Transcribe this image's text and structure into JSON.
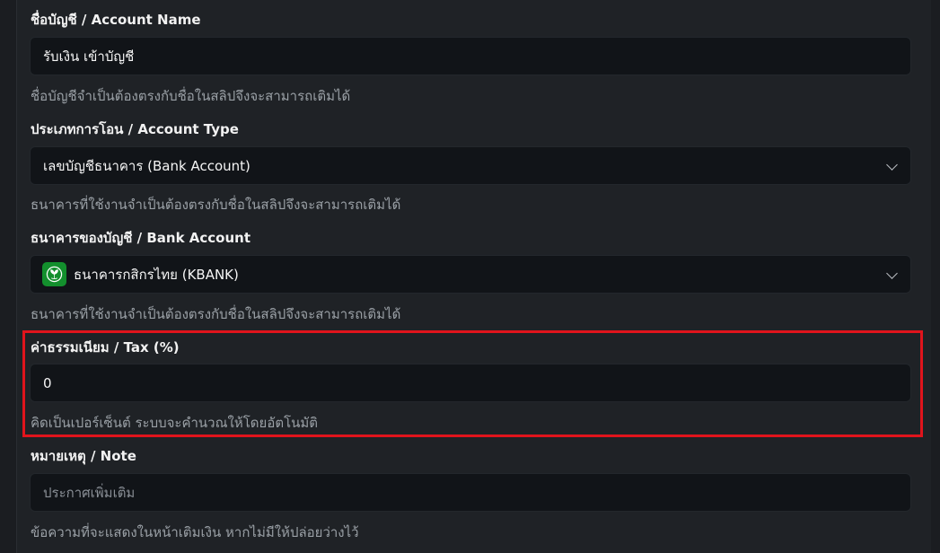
{
  "form": {
    "account_name": {
      "label": "ชื่อบัญชี / Account Name",
      "value": "รับเงิน เข้าบัญชี",
      "hint": "ชื่อบัญชีจำเป็นต้องตรงกับชื่อในสลิปจึงจะสามารถเติมได้"
    },
    "account_type": {
      "label": "ประเภทการโอน / Account Type",
      "value": "เลขบัญชีธนาคาร (Bank Account)",
      "hint": "ธนาคารที่ใช้งานจำเป็นต้องตรงกับชื่อในสลิปจึงจะสามารถเติมได้"
    },
    "bank_account": {
      "label": "ธนาคารของบัญชี / Bank Account",
      "value": "ธนาคารกสิกรไทย (KBANK)",
      "logo_icon": "kbank-logo-icon",
      "logo_color": "#138f2d",
      "hint": "ธนาคารที่ใช้งานจำเป็นต้องตรงกับชื่อในสลิปจึงจะสามารถเติมได้"
    },
    "tax": {
      "label": "ค่าธรรมเนียม / Tax (%)",
      "value": "0",
      "hint": "คิดเป็นเปอร์เซ็นต์ ระบบจะคำนวณให้โดยอัตโนมัติ",
      "highlight_color": "#e0141c"
    },
    "note": {
      "label": "หมายเหตุ / Note",
      "placeholder": "ประกาศเพิ่มเติม",
      "hint": "ข้อความที่จะแสดงในหน้าเติมเงิน หากไม่มีให้ปล่อยว่างไว้"
    }
  },
  "colors": {
    "background": "#1f2226",
    "field_background": "#111418",
    "hint_text": "#9aa0a6"
  }
}
